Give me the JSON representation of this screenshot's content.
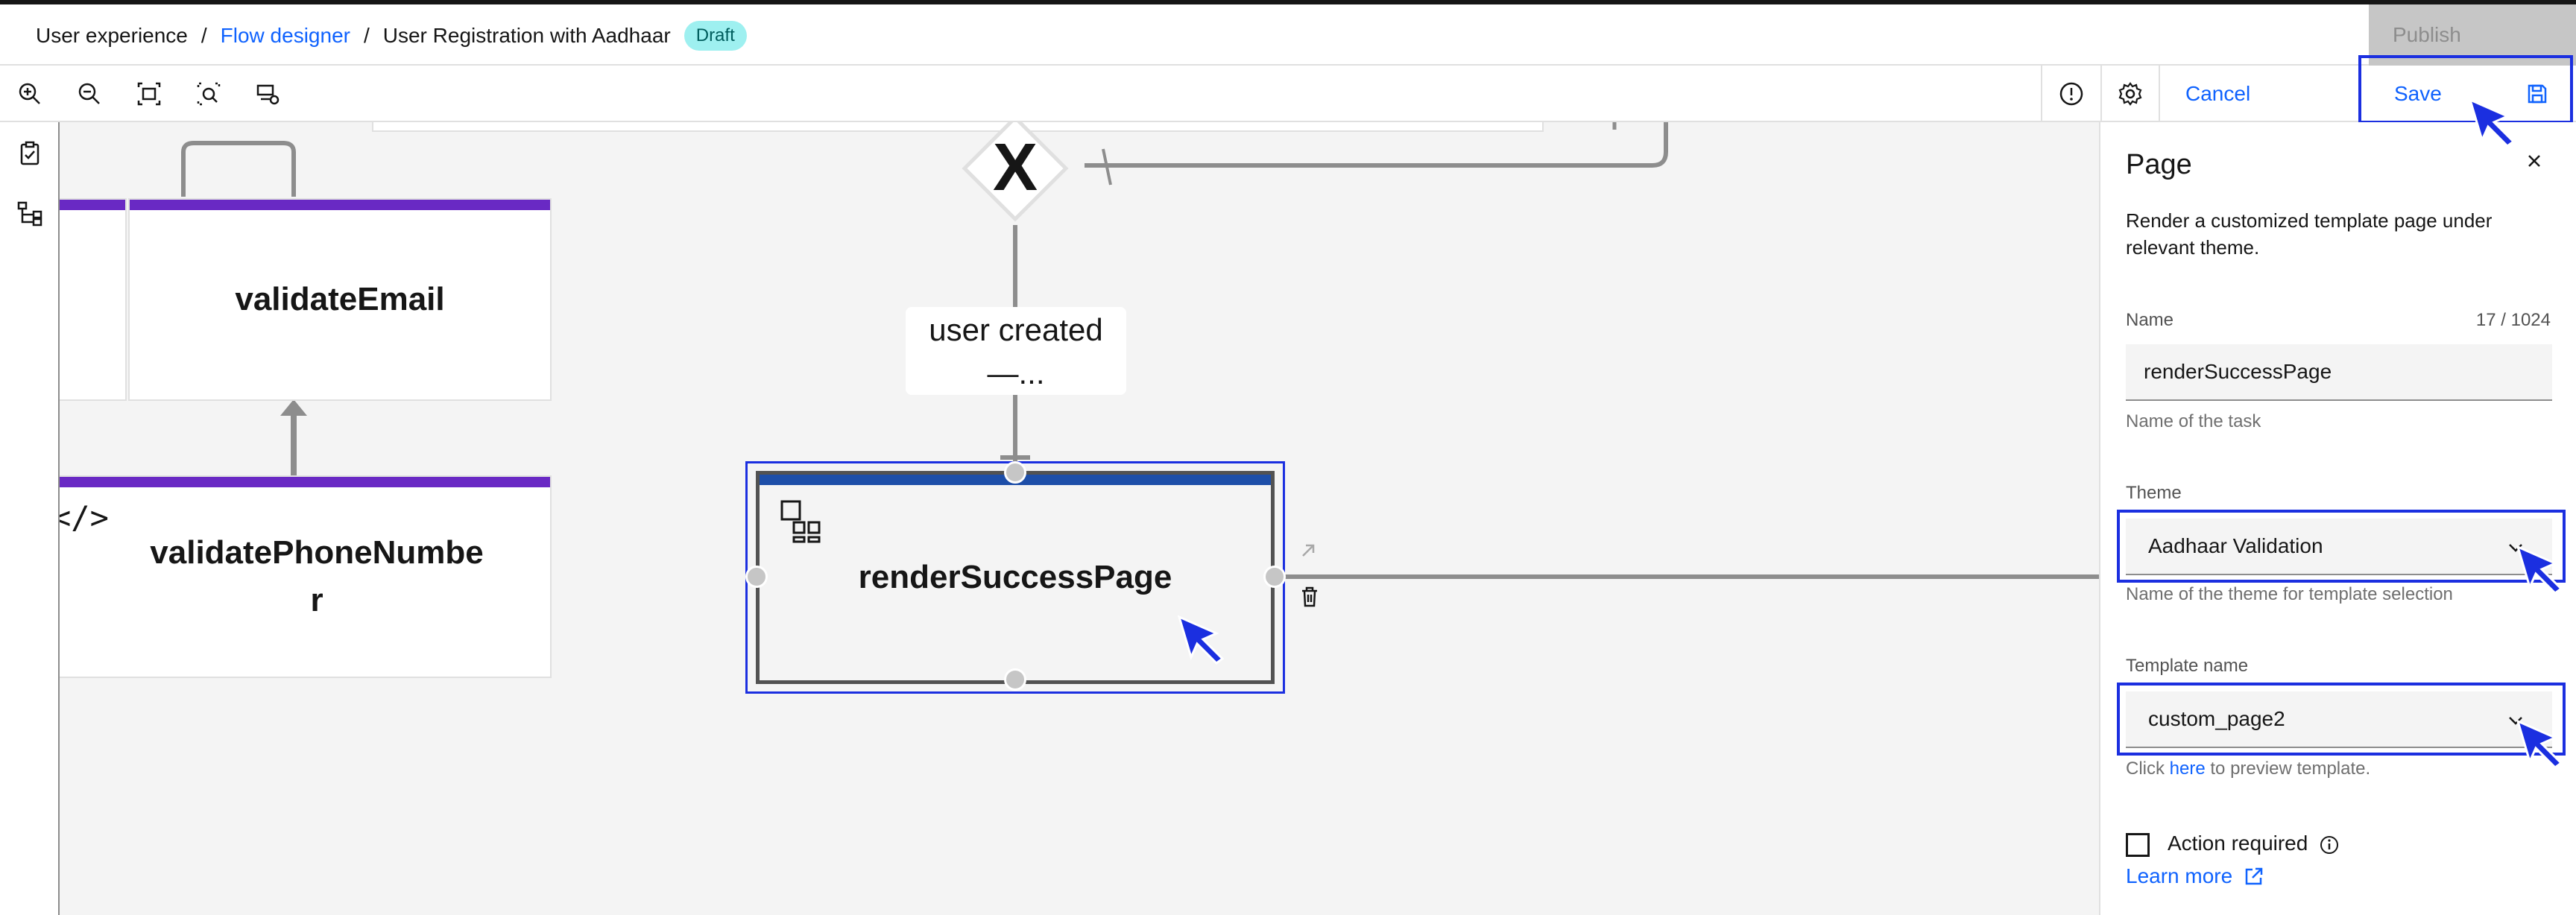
{
  "breadcrumb": {
    "items": [
      "User experience",
      "Flow designer",
      "User Registration with Aadhaar"
    ],
    "separator": "/",
    "status_badge": "Draft"
  },
  "header": {
    "publish_label": "Publish"
  },
  "toolbar": {
    "tools": [
      "zoom-in-icon",
      "zoom-out-icon",
      "fit-to-screen-icon",
      "zoom-area-icon",
      "flow-settings-icon"
    ],
    "cancel_label": "Cancel",
    "save_label": "Save"
  },
  "left_rail": {
    "icons": [
      "task-list-icon",
      "data-flow-icon"
    ]
  },
  "canvas": {
    "nodes": {
      "validate_email": "validateEmail",
      "validate_phone_line1": "validatePhoneNumbe",
      "validate_phone_line2": "r",
      "render_success": "renderSuccessPage"
    },
    "gateway_symbol": "X",
    "edge_label_line1": "user created",
    "edge_label_line2": "—...",
    "script_icon_text": "</>"
  },
  "panel": {
    "title": "Page",
    "description": "Render a customized template page under relevant theme.",
    "name_label": "Name",
    "name_count": "17 / 1024",
    "name_value": "renderSuccessPage",
    "name_helper": "Name of the task",
    "theme_label": "Theme",
    "theme_value": "Aadhaar Validation",
    "theme_helper": "Name of the theme for template selection",
    "template_label": "Template name",
    "template_value": "custom_page2",
    "template_helper_prefix": "Click ",
    "template_helper_link": "here",
    "template_helper_suffix": " to preview template.",
    "action_required_label": "Action required",
    "learn_more_label": "Learn more"
  },
  "colors": {
    "accent": "#0f62fe",
    "annotation": "#1b2fe0",
    "node_bar": "#6929c4",
    "selected_bar": "#1d4ea8",
    "badge_bg": "#9ef0f0"
  }
}
